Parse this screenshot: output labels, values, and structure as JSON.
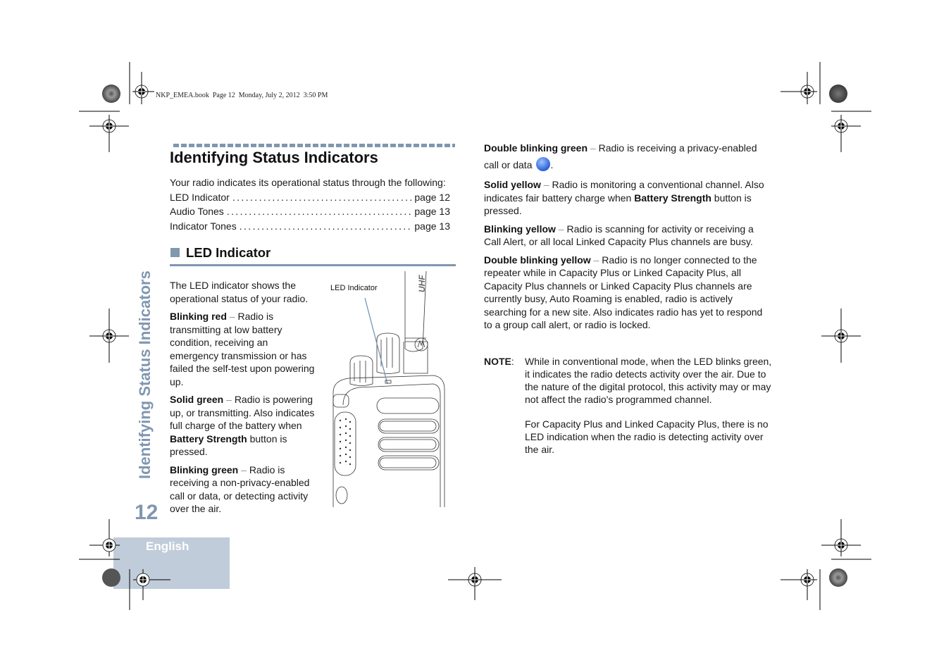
{
  "print_header": "NKP_EMEA.book  Page 12  Monday, July 2, 2012  3:50 PM",
  "side_title": "Identifying Status Indicators",
  "page_number": "12",
  "language_tab": "English",
  "section": {
    "title": "Identifying Status Indicators",
    "intro": "Your radio indicates its operational status through the following:",
    "toc": [
      {
        "label": "LED Indicator",
        "page": "page 12"
      },
      {
        "label": "Audio Tones",
        "page": "page 13"
      },
      {
        "label": "Indicator Tones",
        "page": "page 13"
      }
    ]
  },
  "subsection": {
    "title": "LED Indicator",
    "intro": "The LED indicator shows the operational status of your radio.",
    "figure_callout": "LED Indicator",
    "figure_antenna_label": "UHF"
  },
  "left_items": [
    {
      "term": "Blinking red",
      "sep": " – ",
      "text": "Radio is transmitting at low battery condition, receiving an emergency transmission or has failed the self-test upon powering up."
    },
    {
      "term": "Solid green",
      "sep": " – ",
      "text_before": "Radio is powering up, or transmitting. Also indicates full charge of the battery when ",
      "bold": "Battery Strength",
      "text_after": " button is pressed."
    },
    {
      "term": "Blinking green",
      "sep": " – ",
      "text": "Radio is receiving a non-privacy-enabled call or data, or detecting activity over the air."
    }
  ],
  "right_items": [
    {
      "term": "Double blinking green",
      "sep": " – ",
      "text": "Radio is receiving a privacy-enabled call or data",
      "icon": "privacy-icon",
      "suffix": "."
    },
    {
      "term": "Solid yellow",
      "sep": " – ",
      "text_before": "Radio is monitoring a conventional channel. Also indicates fair battery charge when ",
      "bold": "Battery Strength",
      "text_after": " button is pressed."
    },
    {
      "term": "Blinking yellow",
      "sep": " – ",
      "text": "Radio is scanning for activity or receiving a Call Alert, or all local Linked Capacity Plus channels are busy."
    },
    {
      "term": "Double blinking yellow",
      "sep": " – ",
      "text": "Radio is no longer connected to the repeater while in Capacity Plus or Linked Capacity Plus, all Capacity Plus channels or Linked Capacity Plus channels are currently busy, Auto Roaming is enabled, radio is actively searching for a new site. Also indicates radio has yet to respond to a group call alert, or radio is locked."
    }
  ],
  "note": {
    "label": "NOTE",
    "colon": ":",
    "para1": "While in conventional mode, when the LED blinks green, it indicates the radio detects activity over the air. Due to the nature of the digital protocol, this activity may or may not affect the radio's programmed channel.",
    "para2": "For Capacity Plus and Linked Capacity Plus, there is no LED indication when the radio is detecting activity over the air."
  },
  "colors": {
    "accent": "#8097b0",
    "language_tab_bg": "#c0ccd9",
    "privacy_icon": "#2b5fd9"
  }
}
